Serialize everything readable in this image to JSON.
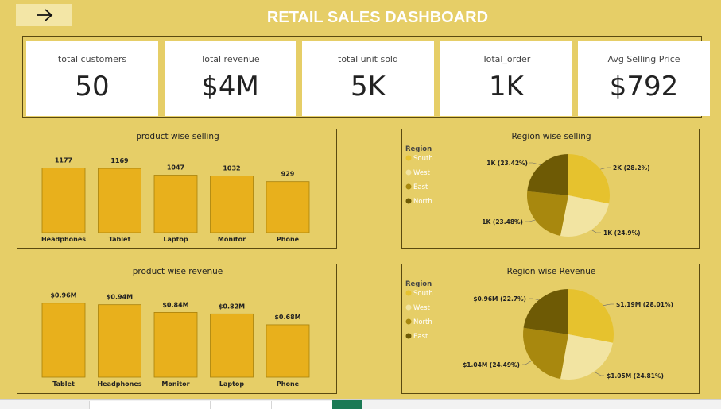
{
  "header": {
    "title": "RETAIL  SALES DASHBOARD",
    "back_icon": "arrow-right-icon"
  },
  "kpis": [
    {
      "label": "total customers",
      "value": "50"
    },
    {
      "label": "Total revenue",
      "value": "$4M"
    },
    {
      "label": "total unit sold",
      "value": "5K"
    },
    {
      "label": "Total_order",
      "value": "1K"
    },
    {
      "label": "Avg Selling Price",
      "value": "$792"
    }
  ],
  "colors": {
    "background": "#e6ce67",
    "bar": "#e8b01c",
    "south": "#e6c22e",
    "west": "#f2e4a2",
    "east": "#a8880e",
    "north": "#6e5a05"
  },
  "chart_data": [
    {
      "type": "bar",
      "title": "product wise selling",
      "categories": [
        "Headphones",
        "Tablet",
        "Laptop",
        "Monitor",
        "Phone"
      ],
      "values": [
        1177,
        1169,
        1047,
        1032,
        929
      ],
      "data_labels": [
        "1177",
        "1169",
        "1047",
        "1032",
        "929"
      ],
      "ylim": [
        0,
        1300
      ]
    },
    {
      "type": "bar",
      "title": "product wise revenue",
      "categories": [
        "Tablet",
        "Headphones",
        "Monitor",
        "Laptop",
        "Phone"
      ],
      "values": [
        0.96,
        0.94,
        0.84,
        0.82,
        0.68
      ],
      "data_labels": [
        "$0.96M",
        "$0.94M",
        "$0.84M",
        "$0.82M",
        "$0.68M"
      ],
      "ylim": [
        0,
        1.05
      ]
    },
    {
      "type": "pie",
      "title": "Region wise selling",
      "legend_title": "Region",
      "legend_position": "left",
      "slices": [
        {
          "name": "South",
          "value": 28.2,
          "label": "2K (28.2%)",
          "color": "#e6c22e"
        },
        {
          "name": "West",
          "value": 24.9,
          "label": "1K (24.9%)",
          "color": "#f2e4a2"
        },
        {
          "name": "East",
          "value": 23.48,
          "label": "1K (23.48%)",
          "color": "#a8880e"
        },
        {
          "name": "North",
          "value": 23.42,
          "label": "1K (23.42%)",
          "color": "#6e5a05"
        }
      ]
    },
    {
      "type": "pie",
      "title": "Region wise Revenue",
      "legend_title": "Region",
      "legend_position": "left",
      "slices": [
        {
          "name": "South",
          "value": 28.01,
          "label": "$1.19M (28.01%)",
          "color": "#e6c22e"
        },
        {
          "name": "West",
          "value": 24.81,
          "label": "$1.05M (24.81%)",
          "color": "#f2e4a2"
        },
        {
          "name": "North",
          "value": 24.49,
          "label": "$1.04M (24.49%)",
          "color": "#a8880e"
        },
        {
          "name": "East",
          "value": 22.7,
          "label": "$0.96M (22.7%)",
          "color": "#6e5a05"
        }
      ]
    }
  ]
}
